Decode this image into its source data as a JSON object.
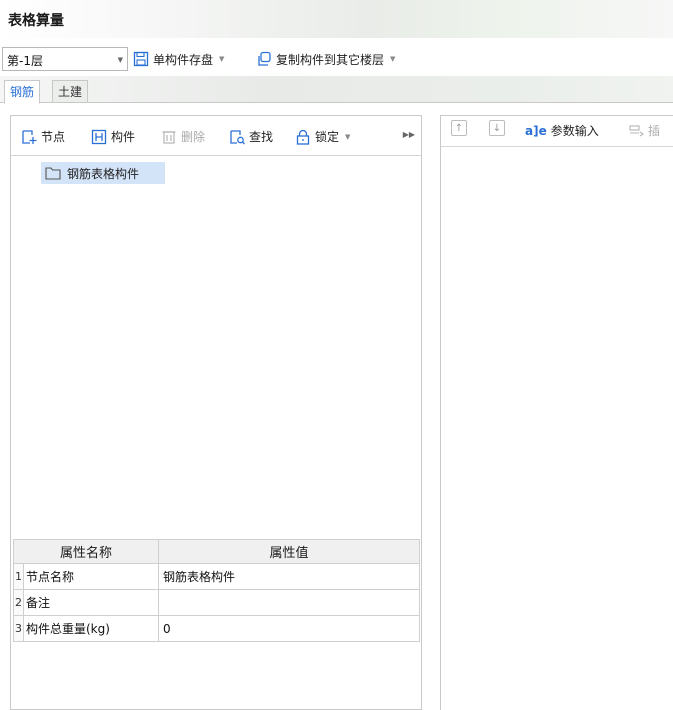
{
  "window": {
    "title": "表格算量"
  },
  "toolbar": {
    "floor_value": "第-1层",
    "save_component_label": "单构件存盘",
    "copy_to_floor_label": "复制构件到其它楼层"
  },
  "tabs": [
    {
      "label": "钢筋",
      "active": true
    },
    {
      "label": "土建",
      "active": false
    }
  ],
  "left_toolbar": {
    "node_label": "节点",
    "component_label": "构件",
    "delete_label": "删除",
    "find_label": "查找",
    "lock_label": "锁定"
  },
  "tree": {
    "root_label": "钢筋表格构件"
  },
  "properties": {
    "headers": {
      "name": "属性名称",
      "value": "属性值"
    },
    "rows": [
      {
        "index": "1",
        "name": "节点名称",
        "value": "钢筋表格构件"
      },
      {
        "index": "2",
        "name": "备注",
        "value": ""
      },
      {
        "index": "3",
        "name": "构件总重量(kg)",
        "value": "0"
      }
    ]
  },
  "right_toolbar": {
    "param_input_label": "参数输入",
    "insert_label": "插"
  },
  "colors": {
    "accent": "#2a6fd6",
    "selection": "#d4e4f8"
  }
}
